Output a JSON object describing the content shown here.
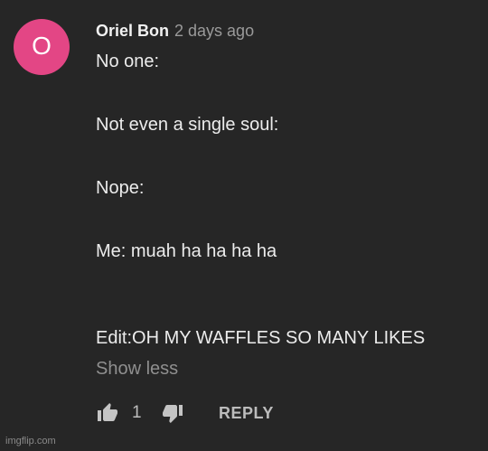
{
  "comment": {
    "avatar_letter": "O",
    "avatar_color": "#e34685",
    "author": "Oriel Bon",
    "timestamp": "2 days ago",
    "lines": {
      "l1": "No one:",
      "l2": "Not even a single soul:",
      "l3": "Nope:",
      "l4": "Me: muah ha ha ha ha",
      "l5": "Edit:OH MY WAFFLES SO MANY LIKES"
    },
    "show_less": "Show less",
    "like_count": "1",
    "reply_label": "REPLY",
    "icons": {
      "like": "thumbs-up-icon",
      "dislike": "thumbs-down-icon"
    }
  },
  "watermark": "imgflip.com"
}
